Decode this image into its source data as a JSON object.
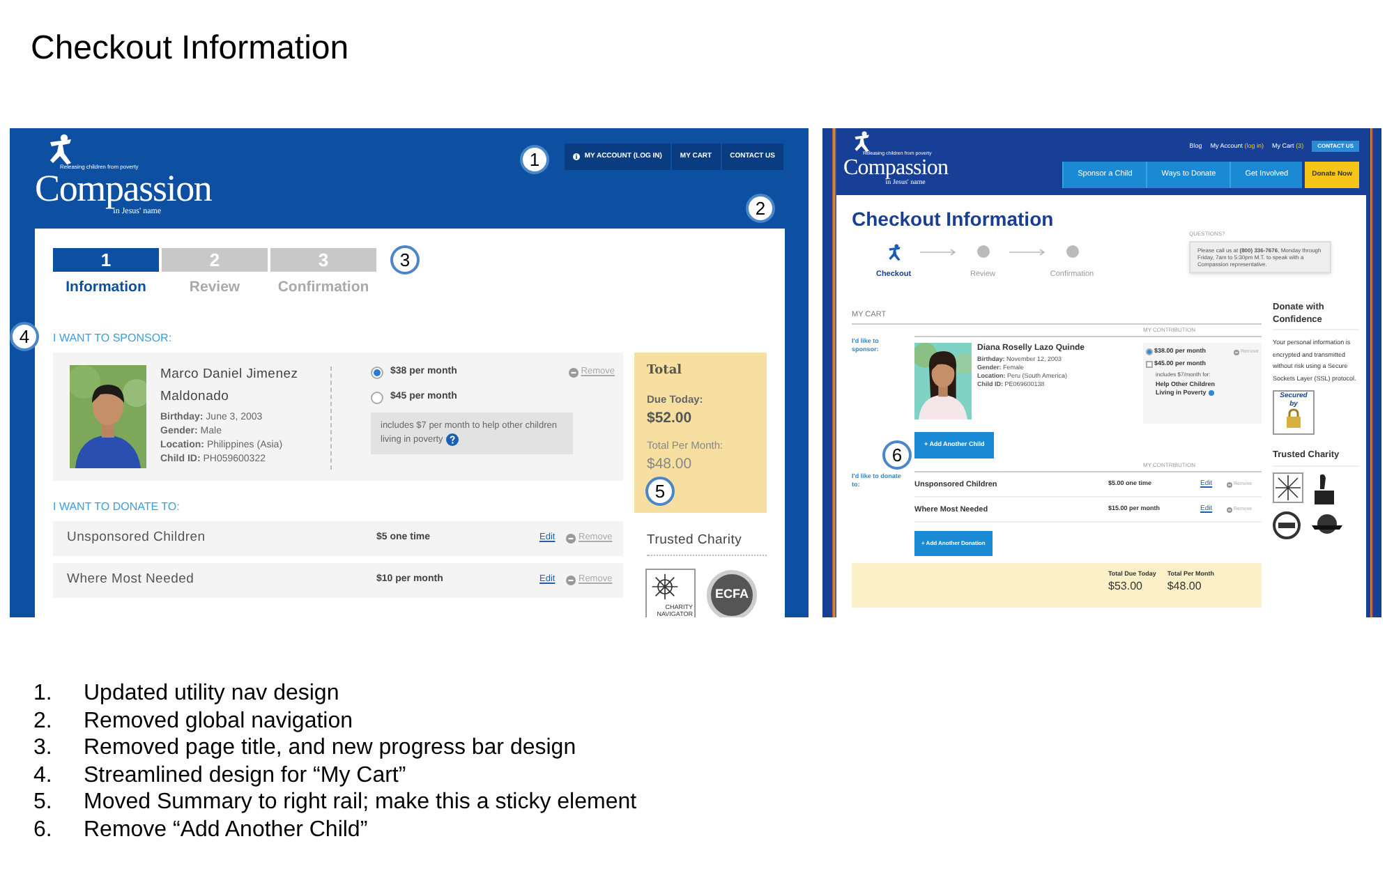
{
  "title": "Checkout Information",
  "new_design": {
    "logo": {
      "tagline": "Releasing children from poverty",
      "name": "Compassion",
      "subtitle": "in Jesus' name"
    },
    "utility_nav": [
      {
        "label": "MY ACCOUNT (LOG IN)"
      },
      {
        "label": "MY CART"
      },
      {
        "label": "CONTACT US"
      }
    ],
    "utility_callout": "1",
    "header_callout": "2",
    "progress": {
      "callout": "3",
      "steps": [
        {
          "number": "1",
          "label": "Information",
          "selected": true
        },
        {
          "number": "2",
          "label": "Review",
          "selected": false
        },
        {
          "number": "3",
          "label": "Confirmation",
          "selected": false
        }
      ]
    },
    "sponsor": {
      "callout": "4",
      "heading": "I WANT TO SPONSOR:",
      "child_name": "Marco Daniel Jimenez Maldonado",
      "details": [
        {
          "label": "Birthday:",
          "value": "June 3, 2003"
        },
        {
          "label": "Gender:",
          "value": "Male"
        },
        {
          "label": "Location:",
          "value": "Philippines (Asia)"
        },
        {
          "label": "Child ID:",
          "value": "PH059600322"
        }
      ],
      "options": [
        {
          "label": "$38 per month",
          "selected": true
        },
        {
          "label": "$45 per month",
          "selected": false
        }
      ],
      "note": "includes $7 per month to help other children living in poverty",
      "remove": "Remove"
    },
    "donate": {
      "heading": "I WANT TO DONATE TO:",
      "rows": [
        {
          "name": "Unsponsored Children",
          "amount": "$5 one time",
          "edit": "Edit",
          "remove": "Remove"
        },
        {
          "name": "Where Most Needed",
          "amount": "$10 per month",
          "edit": "Edit",
          "remove": "Remove"
        }
      ]
    },
    "total": {
      "callout": "5",
      "title": "Total",
      "due_label": "Due Today:",
      "due": "$52.00",
      "monthly_label": "Total Per Month:",
      "monthly": "$48.00"
    },
    "trusted": {
      "heading": "Trusted Charity",
      "badges": [
        {
          "kind": "compass",
          "text": "CHARITY NAVIGATOR"
        },
        {
          "kind": "seal",
          "text": "ECFA"
        }
      ]
    }
  },
  "current_design": {
    "logo": {
      "tagline": "Releasing children from poverty",
      "name": "Compassion",
      "subtitle": "in Jesus' name"
    },
    "top_links": [
      {
        "label": "Blog"
      },
      {
        "label": "My Account",
        "suffix": "(log in)"
      },
      {
        "label": "My Cart",
        "suffix": "(3)"
      }
    ],
    "contact": "CONTACT US",
    "nav": [
      {
        "label": "Sponsor a Child",
        "kind": "tab"
      },
      {
        "label": "Ways to Donate",
        "kind": "tab"
      },
      {
        "label": "Get Involved",
        "kind": "tab"
      },
      {
        "label": "Donate Now",
        "kind": "cta"
      }
    ],
    "page_title": "Checkout Information",
    "progress": [
      {
        "label": "Checkout",
        "selected": true
      },
      {
        "label": "Review",
        "selected": false
      },
      {
        "label": "Confirmation",
        "selected": false
      }
    ],
    "questions": {
      "heading": "QUESTIONS?",
      "text": "Please call us at **(800) 336-7676**, Monday through Friday, 7am to 5:30pm M.T. to speak with a Compassion representative."
    },
    "cart_heading": "MY CART",
    "sponsor": {
      "label": "I'd like to sponsor:",
      "contribution_heading": "MY CONTRIBUTION",
      "child_name": "Diana Roselly Lazo Quinde",
      "details": [
        {
          "label": "Birthday:",
          "value": "November 12, 2003"
        },
        {
          "label": "Gender:",
          "value": "Female"
        },
        {
          "label": "Location:",
          "value": "Peru (South America)"
        },
        {
          "label": "Child ID:",
          "value": "PE069600138"
        }
      ],
      "options": [
        {
          "label": "$38.00 per month",
          "kind": "radio",
          "selected": true
        },
        {
          "label": "$45.00 per month",
          "kind": "checkbox",
          "selected": false
        }
      ],
      "includes": "includes $7/month for:",
      "includes_title": "Help Other Children Living in Poverty",
      "remove": "Remove",
      "add_button": "+ Add Another Child",
      "callout": "6"
    },
    "donate": {
      "label": "I'd like to donate to:",
      "contribution_heading": "MY CONTRIBUTION",
      "rows": [
        {
          "name": "Unsponsored Children",
          "amount": "$5.00 one time",
          "edit": "Edit",
          "remove": "Remove"
        },
        {
          "name": "Where Most Needed",
          "amount": "$15.00 per month",
          "edit": "Edit",
          "remove": "Remove"
        }
      ],
      "add_button": "+ Add Another Donation"
    },
    "totals": [
      {
        "label": "Total Due Today",
        "value": "$53.00"
      },
      {
        "label": "Total Per Month",
        "value": "$48.00"
      }
    ],
    "rail": {
      "heading": "Donate with Confidence",
      "text": "Your personal information is encrypted and transmitted without risk using a Secure Sockets Layer (SSL) protocol.",
      "secured": "Secured by",
      "trusted_heading": "Trusted Charity"
    }
  },
  "notes": [
    {
      "number": "1.",
      "text": "Updated utility nav design"
    },
    {
      "number": "2.",
      "text": "Removed global navigation"
    },
    {
      "number": "3.",
      "text": "Removed page title, and new progress bar design"
    },
    {
      "number": "4.",
      "text": "Streamlined design for “My Cart”"
    },
    {
      "number": "5.",
      "text": "Moved Summary to right rail; make this a sticky element"
    },
    {
      "number": "6.",
      "text": "Remove “Add Another Child”"
    }
  ]
}
